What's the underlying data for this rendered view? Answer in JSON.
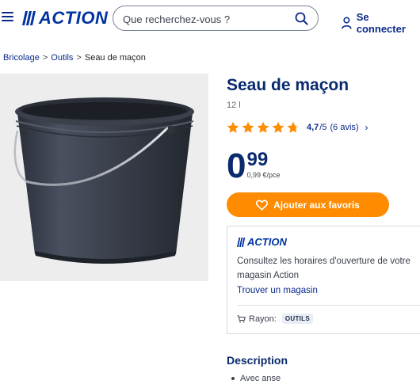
{
  "header": {
    "brand": "ACTION",
    "search": {
      "placeholder": "Que recherchez-vous ?",
      "value": ""
    },
    "login_label": "Se connecter"
  },
  "breadcrumb": {
    "items": [
      "Bricolage",
      "Outils"
    ],
    "current": "Seau de maçon",
    "separator": ">"
  },
  "product": {
    "title": "Seau de maçon",
    "volume": "12 l",
    "rating": {
      "score": "4,7",
      "scale": "/5",
      "count": "(6 avis)",
      "stars": 4.7
    },
    "price": {
      "integer": "0",
      "cents": "99",
      "unit_price": "0,99 €/pce"
    },
    "favorite_button": "Ajouter aux favoris"
  },
  "store": {
    "brand": "ACTION",
    "text": "Consultez les horaires d'ouverture de votre magasin Action",
    "link": "Trouver un magasin",
    "rayon_label": "Rayon:",
    "rayon_value": "OUTILS"
  },
  "description": {
    "title": "Description",
    "items": [
      "Avec anse"
    ]
  },
  "colors": {
    "brand_blue": "#0033a0",
    "title_navy": "#0a2a6e",
    "accent_orange": "#ff8c00",
    "star_orange": "#ff8c00",
    "image_bg": "#ededed"
  },
  "icons": {
    "menu": "hamburger-icon",
    "search": "search-icon",
    "user": "user-icon",
    "star": "star-icon",
    "chevron": "chevron-right-icon",
    "heart": "heart-icon",
    "cart": "cart-icon"
  }
}
